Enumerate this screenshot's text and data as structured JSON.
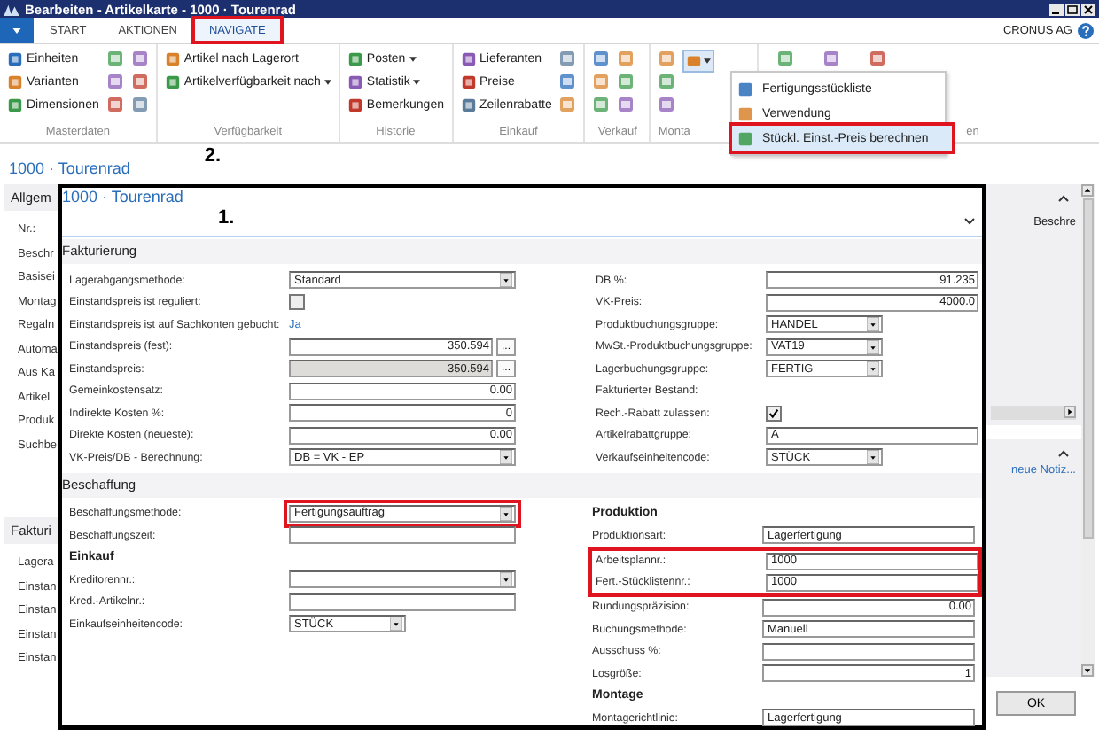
{
  "window": {
    "title": "Bearbeiten - Artikelkarte - 1000 · Tourenrad"
  },
  "ribbon_tabs": [
    {
      "label": "START",
      "selected": false,
      "highlighted": false
    },
    {
      "label": "AKTIONEN",
      "selected": false,
      "highlighted": false
    },
    {
      "label": "NAVIGATE",
      "selected": true,
      "highlighted": true
    }
  ],
  "company": "CRONUS AG",
  "ribbon_groups": [
    {
      "label": "Masterdaten",
      "items": [
        {
          "label": "Einheiten",
          "dropdown": false
        },
        {
          "label": "Varianten",
          "dropdown": false
        },
        {
          "label": "Dimensionen",
          "dropdown": false
        }
      ]
    },
    {
      "label": "Verfügbarkeit",
      "items": [
        {
          "label": "Artikel nach Lagerort",
          "dropdown": false
        },
        {
          "label": "Artikelverfügbarkeit nach",
          "dropdown": true
        }
      ]
    },
    {
      "label": "Historie",
      "items": [
        {
          "label": "Posten",
          "dropdown": true
        },
        {
          "label": "Statistik",
          "dropdown": true
        },
        {
          "label": "Bemerkungen",
          "dropdown": false
        }
      ]
    },
    {
      "label": "Einkauf",
      "items": [
        {
          "label": "Lieferanten",
          "dropdown": false
        },
        {
          "label": "Preise",
          "dropdown": false
        },
        {
          "label": "Zeilenrabatte",
          "dropdown": false
        }
      ]
    },
    {
      "label": "Verkauf"
    },
    {
      "label": "Monta"
    },
    {
      "label": "en"
    }
  ],
  "menu": [
    {
      "label": "Fertigungsstückliste",
      "highlighted": false
    },
    {
      "label": "Verwendung",
      "highlighted": false
    },
    {
      "label": "Stückl. Einst.-Preis berechnen",
      "highlighted": true
    }
  ],
  "page_title": "1000 · Tourenrad",
  "annotations": [
    "2.",
    "1."
  ],
  "background": {
    "tab": "Allgem",
    "labels": [
      "Nr.:",
      "Beschr",
      "Basisei",
      "Montag",
      "Regaln",
      "Automa",
      "Aus Ka",
      "Artikel",
      "Produk",
      "Suchbe"
    ],
    "section": "Fakturi",
    "section_labels": [
      "Lagera",
      "Einstan",
      "Einstan",
      "Einstan",
      "Einstan"
    ]
  },
  "factbox": {
    "heading": "Beschre",
    "link": "neue Notiz..."
  },
  "ok_button": "OK",
  "dialog": {
    "title": "1000 · Tourenrad",
    "sections": [
      {
        "title": "Fakturierung",
        "columns": [
          [
            {
              "kind": "dropdown",
              "label": "Lagerabgangsmethode:",
              "value": "Standard"
            },
            {
              "kind": "checkbox",
              "label": "Einstandspreis ist reguliert:",
              "checked": false
            },
            {
              "kind": "link",
              "label": "Einstandspreis ist auf Sachkonten gebucht:",
              "value": "Ja"
            },
            {
              "kind": "lookup",
              "label": "Einstandspreis (fest):",
              "value": "350.594",
              "disabled": false,
              "button": "..."
            },
            {
              "kind": "lookup",
              "label": "Einstandspreis:",
              "value": "350.594",
              "disabled": true,
              "button": "..."
            },
            {
              "kind": "number",
              "label": "Gemeinkostensatz:",
              "value": "0.00"
            },
            {
              "kind": "number",
              "label": "Indirekte Kosten %:",
              "value": "0"
            },
            {
              "kind": "number",
              "label": "Direkte Kosten (neueste):",
              "value": "0.00"
            },
            {
              "kind": "dropdown",
              "label": "VK-Preis/DB - Berechnung:",
              "value": "DB = VK - EP"
            }
          ],
          [
            {
              "kind": "number",
              "label": "DB %:",
              "value": "91.235"
            },
            {
              "kind": "number",
              "label": "VK-Preis:",
              "value": "4000.0"
            },
            {
              "kind": "code",
              "label": "Produktbuchungsgruppe:",
              "value": "HANDEL"
            },
            {
              "kind": "code",
              "label": "MwSt.-Produktbuchungsgruppe:",
              "value": "VAT19"
            },
            {
              "kind": "code",
              "label": "Lagerbuchungsgruppe:",
              "value": "FERTIG"
            },
            {
              "kind": "none",
              "label": "Fakturierter Bestand:"
            },
            {
              "kind": "checkbox",
              "label": "Rech.-Rabatt zulassen:",
              "checked": true
            },
            {
              "kind": "text",
              "label": "Artikelrabattgruppe:",
              "value": "A"
            },
            {
              "kind": "code",
              "label": "Verkaufseinheitencode:",
              "value": "STÜCK"
            }
          ]
        ]
      },
      {
        "title": "Beschaffung",
        "columns": [
          [
            {
              "kind": "dropdown",
              "label": "Beschaffungsmethode:",
              "value": "Fertigungsauftrag",
              "highlighted": true
            },
            {
              "kind": "text",
              "label": "Beschaffungszeit:"
            },
            {
              "kind": "heading",
              "label": "Einkauf"
            },
            {
              "kind": "dropdown",
              "label": "Kreditorennr.:"
            },
            {
              "kind": "text",
              "label": "Kred.-Artikelnr.:"
            },
            {
              "kind": "code",
              "label": "Einkaufseinheitencode:",
              "value": "STÜCK"
            }
          ],
          [
            {
              "kind": "heading",
              "label": "Produktion"
            },
            {
              "kind": "text",
              "label": "Produktionsart:",
              "value": "Lagerfertigung"
            },
            {
              "kind": "text",
              "label": "Arbeitsplannr.:",
              "value": "1000",
              "highlighted": true
            },
            {
              "kind": "text",
              "label": "Fert.-Stücklistennr.:",
              "value": "1000",
              "highlighted": true
            },
            {
              "kind": "number",
              "label": "Rundungspräzision:",
              "value": "0.00"
            },
            {
              "kind": "text",
              "label": "Buchungsmethode:",
              "value": "Manuell"
            },
            {
              "kind": "text",
              "label": "Ausschuss %:"
            },
            {
              "kind": "number",
              "label": "Losgröße:",
              "value": "1"
            },
            {
              "kind": "heading",
              "label": "Montage"
            },
            {
              "kind": "text",
              "label": "Montagerichtlinie:",
              "value": "Lagerfertigung"
            }
          ]
        ]
      }
    ]
  }
}
